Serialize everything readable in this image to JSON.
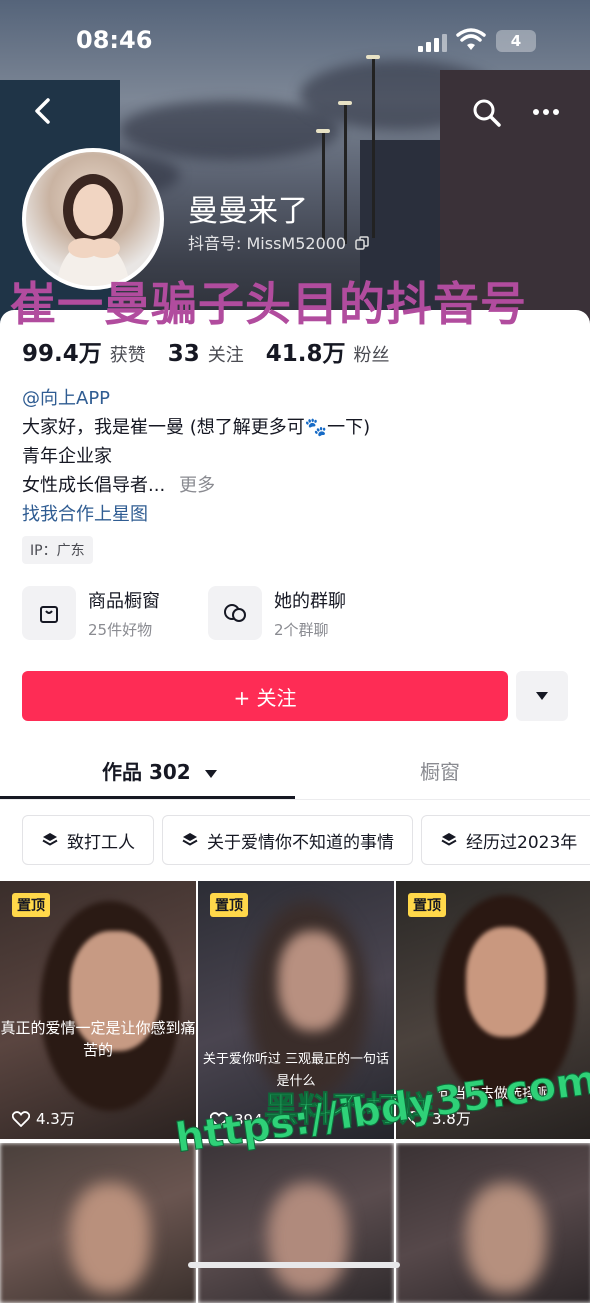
{
  "status_bar": {
    "time": "08:46",
    "battery": "4"
  },
  "profile": {
    "nickname": "曼曼来了",
    "douyin_id": "抖音号: MissM52000",
    "overlay_title": "崔一曼骗子头目的抖音号"
  },
  "stats": [
    {
      "num": "99.4万",
      "label": "获赞"
    },
    {
      "num": "33",
      "label": "关注"
    },
    {
      "num": "41.8万",
      "label": "粉丝"
    }
  ],
  "bio": {
    "mention": "@向上APP",
    "line1": "大家好，我是崔一曼 (想了解更多可🐾一下)",
    "line2": "青年企业家",
    "line3": "女性成长倡导者...",
    "more": "更多",
    "cooperation_link": "找我合作上星图",
    "ip": "IP：广东"
  },
  "shortcuts": [
    {
      "title": "商品橱窗",
      "sub": "25件好物",
      "icon": "shopping-bag-icon"
    },
    {
      "title": "她的群聊",
      "sub": "2个群聊",
      "icon": "chat-bubbles-icon"
    }
  ],
  "follow_button": "+ 关注",
  "tabs": {
    "works": "作品 302",
    "shop": "橱窗"
  },
  "playlists": [
    "致打工人",
    "关于爱情你不知道的事情",
    "经历过2023年"
  ],
  "videos": [
    {
      "pinned": "置顶",
      "likes": "4.3万",
      "caption": "真正的爱情一定是让你感到痛苦的"
    },
    {
      "pinned": "置顶",
      "likes": "394",
      "caption": "关于爱你听过 三观最正的一句话是什么"
    },
    {
      "pinned": "置顶",
      "likes": "3.8万",
      "caption": "句当中去做选择呢"
    }
  ],
  "watermark": {
    "line1": "黑料不打烊",
    "line2": "https://ibdy35.com"
  },
  "colors": {
    "follow": "#fe2c55",
    "link": "#2f5c92",
    "pin": "#ffd84a",
    "overlay": "#b14c9e",
    "watermark": "#2fd178"
  }
}
